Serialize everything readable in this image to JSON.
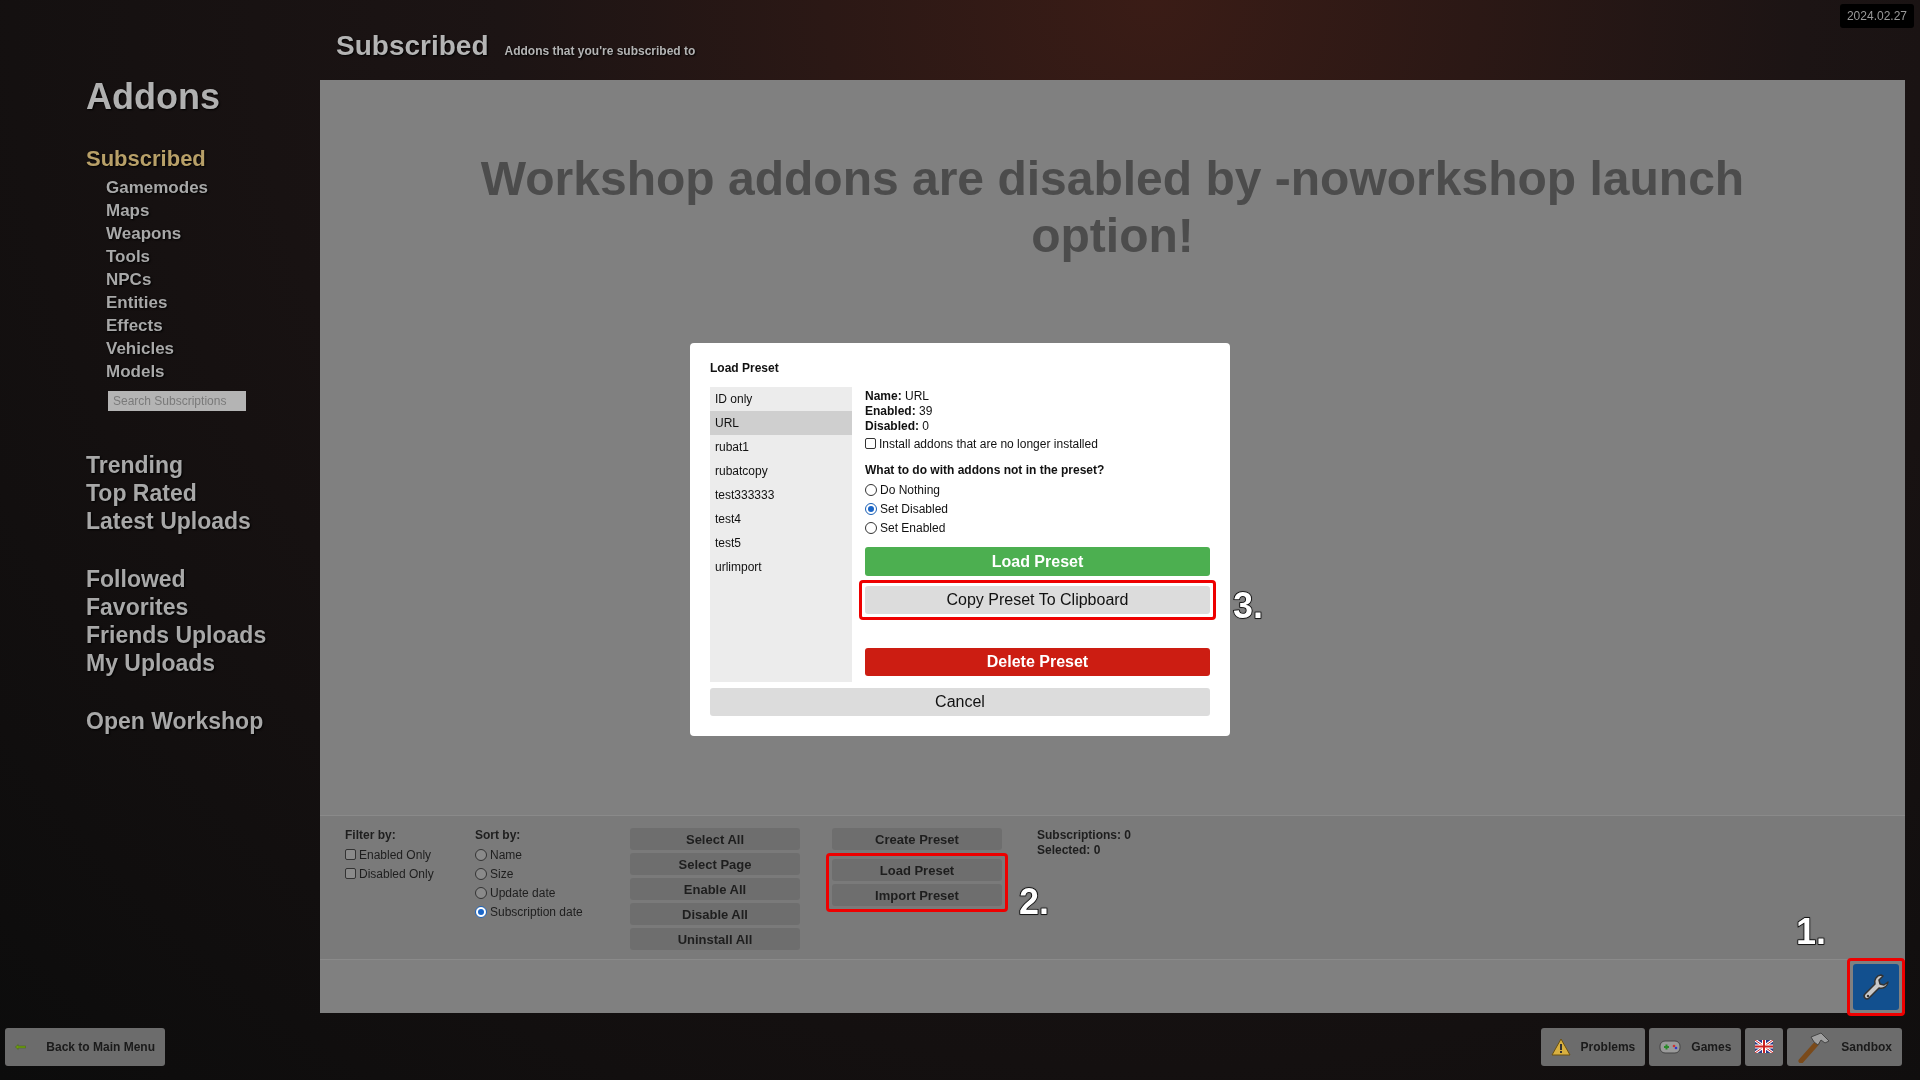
{
  "date": "2024.02.27",
  "header": {
    "title": "Subscribed",
    "subtitle": "Addons that you're subscribed to"
  },
  "sidebar": {
    "title": "Addons",
    "heading": {
      "label": "Subscribed",
      "selected": true
    },
    "categories": [
      {
        "label": "Gamemodes",
        "selected": false
      },
      {
        "label": "Maps",
        "selected": false
      },
      {
        "label": "Weapons",
        "selected": false
      },
      {
        "label": "Tools",
        "selected": false
      },
      {
        "label": "NPCs",
        "selected": false
      },
      {
        "label": "Entities",
        "selected": false
      },
      {
        "label": "Effects",
        "selected": false
      },
      {
        "label": "Vehicles",
        "selected": false
      },
      {
        "label": "Models",
        "selected": false
      }
    ],
    "search": {
      "placeholder": "Search Subscriptions"
    },
    "groups": [
      {
        "items": [
          {
            "label": "Trending",
            "selected": false
          },
          {
            "label": "Top Rated",
            "selected": false
          },
          {
            "label": "Latest Uploads",
            "selected": false
          }
        ]
      },
      {
        "items": [
          {
            "label": "Followed",
            "selected": false
          },
          {
            "label": "Favorites",
            "selected": false
          },
          {
            "label": "Friends Uploads",
            "selected": false
          },
          {
            "label": "My Uploads",
            "selected": false
          }
        ]
      },
      {
        "items": [
          {
            "label": "Open Workshop",
            "selected": false
          }
        ]
      }
    ]
  },
  "message": "Workshop addons are disabled by -noworkshop launch option!",
  "dialog": {
    "title": "Load Preset",
    "presets": [
      {
        "label": "ID only",
        "selected": false
      },
      {
        "label": "URL",
        "selected": true
      },
      {
        "label": "rubat1",
        "selected": false
      },
      {
        "label": "rubatcopy",
        "selected": false
      },
      {
        "label": "test333333",
        "selected": false
      },
      {
        "label": "test4",
        "selected": false
      },
      {
        "label": "test5",
        "selected": false
      },
      {
        "label": "urlimport",
        "selected": false
      }
    ],
    "details": [
      {
        "label": "Name:",
        "value": "URL"
      },
      {
        "label": "Enabled:",
        "value": "39"
      },
      {
        "label": "Disabled:",
        "value": "0"
      }
    ],
    "install_missing": {
      "label": "Install addons that are no longer installed",
      "checked": false
    },
    "question": "What to do with addons not in the preset?",
    "options": [
      {
        "label": "Do Nothing",
        "selected": false
      },
      {
        "label": "Set Disabled",
        "selected": true
      },
      {
        "label": "Set Enabled",
        "selected": false
      }
    ],
    "buttons": [
      {
        "kind": "load",
        "label": "Load Preset",
        "highlighted": false
      },
      {
        "kind": "copy",
        "label": "Copy Preset To Clipboard",
        "highlighted": true,
        "callout": "3."
      },
      {
        "kind": "delete",
        "label": "Delete Preset",
        "highlighted": false
      }
    ],
    "cancel": "Cancel"
  },
  "toolbar": {
    "filter": {
      "title": "Filter by:",
      "options": [
        {
          "label": "Enabled Only",
          "checked": false
        },
        {
          "label": "Disabled Only",
          "checked": false
        }
      ]
    },
    "sort": {
      "title": "Sort by:",
      "options": [
        {
          "label": "Name",
          "selected": false
        },
        {
          "label": "Size",
          "selected": false
        },
        {
          "label": "Update date",
          "selected": false
        },
        {
          "label": "Subscription date",
          "selected": true
        }
      ]
    },
    "actions": [
      "Select All",
      "Select Page",
      "Enable All",
      "Disable All",
      "Uninstall All"
    ],
    "presets": {
      "callout": "2.",
      "buttons": [
        {
          "label": "Create Preset",
          "highlighted": false
        },
        {
          "label": "Load Preset",
          "highlighted": true
        },
        {
          "label": "Import Preset",
          "highlighted": true
        }
      ]
    },
    "stats": [
      {
        "label": "Subscriptions:",
        "value": "0"
      },
      {
        "label": "Selected:",
        "value": "0"
      }
    ]
  },
  "tools_button": {
    "highlighted": true,
    "callout": "1."
  },
  "bottom_bar": {
    "back": "Back to Main Menu",
    "buttons": [
      {
        "kind": "problems",
        "label": "Problems"
      },
      {
        "kind": "games",
        "label": "Games"
      },
      {
        "kind": "language"
      },
      {
        "kind": "sandbox",
        "label": "Sandbox"
      }
    ]
  }
}
